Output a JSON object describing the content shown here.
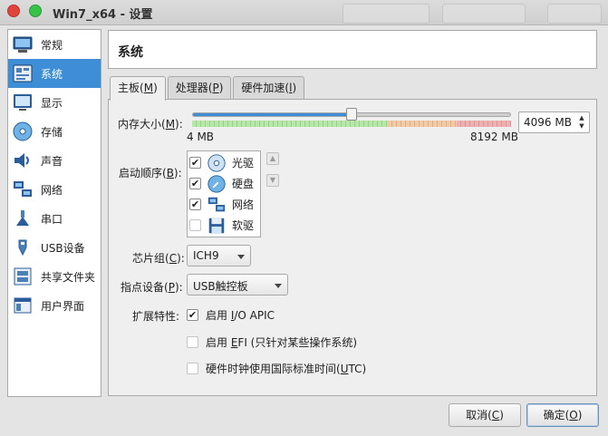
{
  "window": {
    "title": "Win7_x64 - 设置"
  },
  "sidebar": {
    "items": [
      {
        "label": "常规",
        "icon": "general-icon"
      },
      {
        "label": "系统",
        "icon": "system-icon",
        "selected": true
      },
      {
        "label": "显示",
        "icon": "display-icon"
      },
      {
        "label": "存储",
        "icon": "storage-icon"
      },
      {
        "label": "声音",
        "icon": "audio-icon"
      },
      {
        "label": "网络",
        "icon": "network-icon"
      },
      {
        "label": "串口",
        "icon": "serial-port-icon"
      },
      {
        "label": "USB设备",
        "icon": "usb-icon"
      },
      {
        "label": "共享文件夹",
        "icon": "shared-folder-icon"
      },
      {
        "label": "用户界面",
        "icon": "user-interface-icon"
      }
    ]
  },
  "header": {
    "title": "系统"
  },
  "tabs": [
    {
      "label": "主板",
      "mnemonic": "M",
      "active": true
    },
    {
      "label": "处理器",
      "mnemonic": "P"
    },
    {
      "label": "硬件加速",
      "mnemonic": "l"
    }
  ],
  "motherboard": {
    "memory": {
      "label": "内存大小(",
      "mnemonic": "M",
      "label_end": "):",
      "min_label": "4 MB",
      "max_label": "8192 MB",
      "value_text": "4096 MB",
      "slider_fraction": 0.5
    },
    "boot_order": {
      "label": "启动顺序(",
      "mnemonic": "B",
      "label_end": "):",
      "items": [
        {
          "label": "光驱",
          "checked": true,
          "icon": "optical-disc-icon"
        },
        {
          "label": "硬盘",
          "checked": true,
          "icon": "hard-disk-icon"
        },
        {
          "label": "网络",
          "checked": true,
          "icon": "network-icon"
        },
        {
          "label": "软驱",
          "checked": false,
          "icon": "floppy-icon"
        }
      ]
    },
    "chipset": {
      "label": "芯片组(",
      "mnemonic": "C",
      "label_end": "):",
      "value": "ICH9"
    },
    "pointing": {
      "label": "指点设备(",
      "mnemonic": "P",
      "label_end": "):",
      "value": "USB触控板"
    },
    "extended": {
      "label": "扩展特性:",
      "ioapic": {
        "label_pre": "启用 ",
        "mnemonic": "I",
        "label_post": "/O APIC",
        "checked": true
      },
      "efi": {
        "label_pre": "启用 ",
        "mnemonic": "E",
        "label_post": "FI (只针对某些操作系统)",
        "checked": false
      },
      "utc": {
        "label_pre": "硬件时钟使用国际标准时间(",
        "mnemonic": "U",
        "label_post": "TC)",
        "checked": false
      }
    }
  },
  "buttons": {
    "cancel": {
      "label": "取消(",
      "mnemonic": "C",
      "label_end": ")"
    },
    "ok": {
      "label": "确定(",
      "mnemonic": "O",
      "label_end": ")"
    }
  },
  "colors": {
    "accent": "#3d8ed6",
    "zone_green": "#b6e8a6",
    "zone_orange": "#f4c9a4",
    "zone_red": "#f0b0b0"
  }
}
